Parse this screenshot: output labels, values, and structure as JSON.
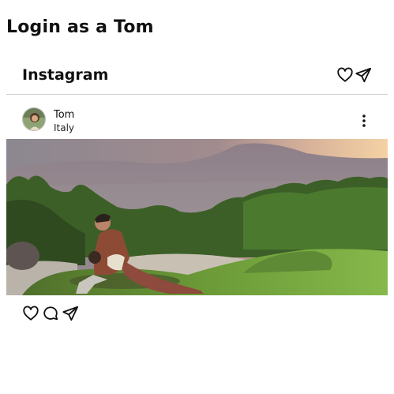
{
  "page": {
    "title": "Login as a Tom"
  },
  "header": {
    "brand": "Instagram",
    "icons": [
      "heart-icon",
      "paper-plane-icon"
    ]
  },
  "post": {
    "user": {
      "name": "Tom",
      "location": "Italy"
    },
    "menu_icon": "more-vertical-icon",
    "image_description_colors": {
      "sky": "#8c7e86",
      "sunset_glow": "#f2c48d",
      "foliage": "#3f6a2a",
      "grass": "#7fb044"
    },
    "actions": [
      "heart-icon",
      "comment-icon",
      "paper-plane-icon"
    ]
  }
}
